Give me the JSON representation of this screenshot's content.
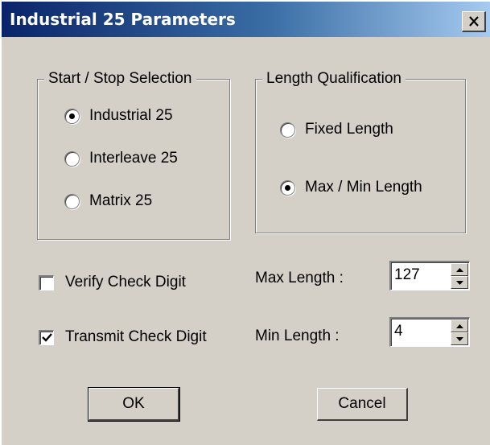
{
  "window": {
    "title": "Industrial 25 Parameters",
    "close_label": "X"
  },
  "start_stop": {
    "legend": "Start / Stop Selection",
    "options": [
      {
        "label": "Industrial 25",
        "selected": true
      },
      {
        "label": "Interleave 25",
        "selected": false
      },
      {
        "label": "Matrix 25",
        "selected": false
      }
    ]
  },
  "length_qualification": {
    "legend": "Length Qualification",
    "options": [
      {
        "label": "Fixed Length",
        "selected": false
      },
      {
        "label": "Max / Min Length",
        "selected": true
      }
    ]
  },
  "checks": {
    "verify": {
      "label": "Verify Check Digit",
      "checked": false
    },
    "transmit": {
      "label": "Transmit Check Digit",
      "checked": true
    }
  },
  "lengths": {
    "max_label": "Max Length :",
    "max_value": "127",
    "min_label": "Min Length :",
    "min_value": "4"
  },
  "buttons": {
    "ok": "OK",
    "cancel": "Cancel"
  },
  "icons": {
    "radio_selected": "radio-dot",
    "checkbox_checked": "check-mark",
    "spin_up": "up-arrow",
    "spin_down": "down-arrow"
  },
  "colors": {
    "title_gradient_start": "#0a246a",
    "title_gradient_end": "#a6caf0",
    "face": "#d4d0c8"
  }
}
